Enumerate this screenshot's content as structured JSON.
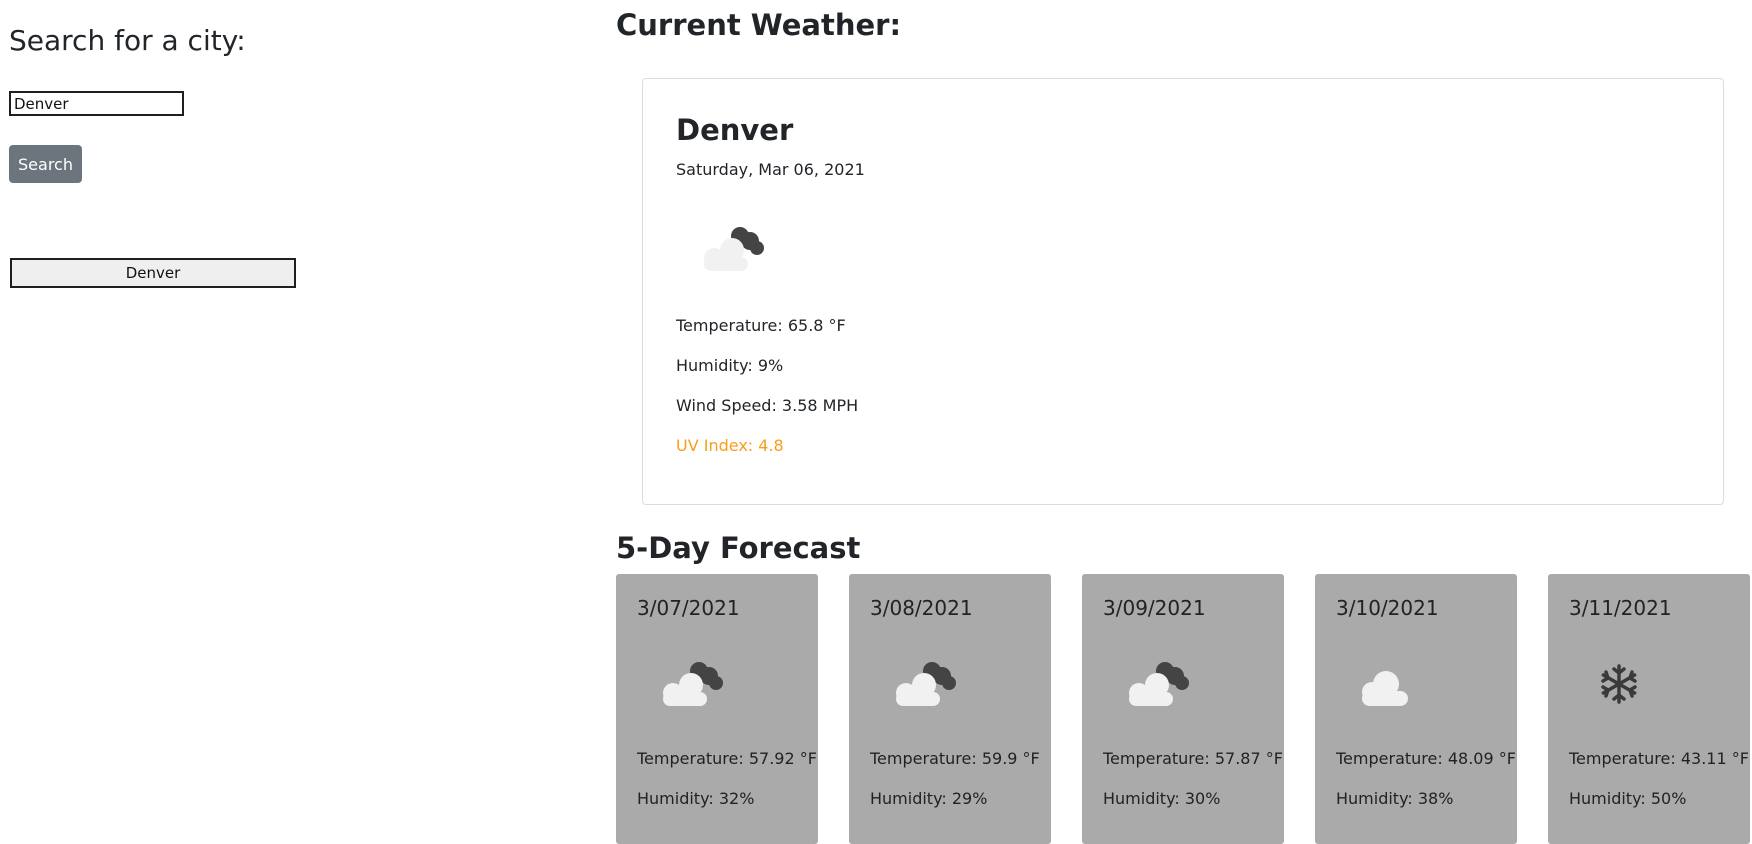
{
  "search": {
    "title": "Search for a city:",
    "input_value": "Denver",
    "button_label": "Search"
  },
  "history": {
    "items": [
      {
        "label": "Denver"
      }
    ]
  },
  "current": {
    "heading": "Current Weather:",
    "city": "Denver",
    "date": "Saturday, Mar 06, 2021",
    "icon": "partly-cloudy-icon",
    "temperature": "Temperature: 65.8 °F",
    "humidity": "Humidity: 9%",
    "wind": "Wind Speed: 3.58 MPH",
    "uv": "UV Index: 4.8",
    "uv_color": "#f89e1a"
  },
  "forecast": {
    "heading": "5-Day Forecast",
    "days": [
      {
        "date": "3/07/2021",
        "icon": "partly-cloudy-icon",
        "temperature": "Temperature: 57.92 °F",
        "humidity": "Humidity: 32%"
      },
      {
        "date": "3/08/2021",
        "icon": "partly-cloudy-icon",
        "temperature": "Temperature: 59.9 °F",
        "humidity": "Humidity: 29%"
      },
      {
        "date": "3/09/2021",
        "icon": "partly-cloudy-icon",
        "temperature": "Temperature: 57.87 °F",
        "humidity": "Humidity: 30%"
      },
      {
        "date": "3/10/2021",
        "icon": "cloud-icon",
        "temperature": "Temperature: 48.09 °F",
        "humidity": "Humidity: 38%"
      },
      {
        "date": "3/11/2021",
        "icon": "snowflake-icon",
        "temperature": "Temperature: 43.11 °F",
        "humidity": "Humidity: 50%"
      }
    ],
    "card_color": "#aaaaaa"
  }
}
